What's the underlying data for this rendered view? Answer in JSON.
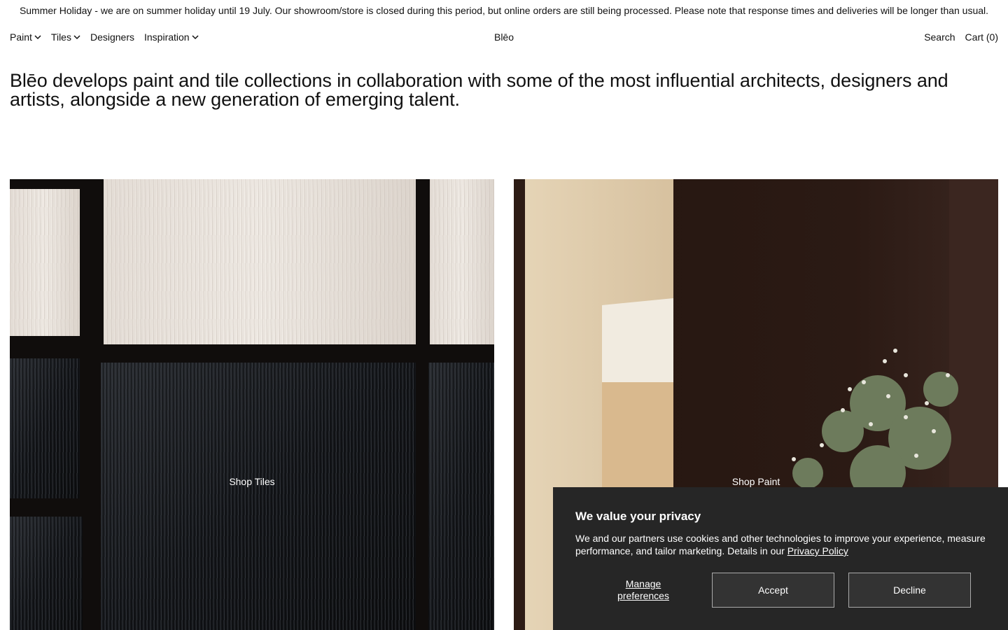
{
  "announcement": "Summer Holiday - we are on summer holiday until 19 July. Our showroom/store is closed during this period, but online orders are still being processed. Please note that response times and deliveries will be longer than usual.",
  "nav": {
    "items": [
      {
        "label": "Paint",
        "icon": "chevron-down-icon"
      },
      {
        "label": "Tiles",
        "icon": "chevron-down-icon"
      },
      {
        "label": "Designers"
      },
      {
        "label": "Inspiration",
        "icon": "chevron-down-icon"
      }
    ],
    "logo": "Blēo",
    "search": "Search",
    "cart": "Cart (0)"
  },
  "intro": "Blēo develops paint and tile collections in collaboration with some of the most influential architects, designers and artists, alongside a new generation of emerging talent.",
  "tiles": {
    "left_label": "Shop Tiles",
    "right_label": "Shop Paint"
  },
  "cookie": {
    "title": "We value your privacy",
    "text": "We and our partners use cookies and other technologies to improve your experience, measure performance, and tailor marketing. Details in our ",
    "link": "Privacy Policy",
    "manage": "Manage preferences",
    "accept": "Accept",
    "decline": "Decline"
  }
}
